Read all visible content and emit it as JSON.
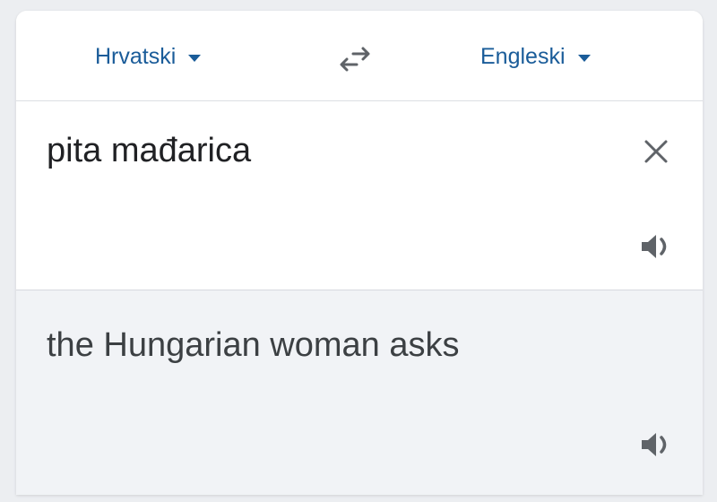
{
  "languages": {
    "source_label": "Hrvatski",
    "target_label": "Engleski"
  },
  "input": {
    "text": "pita mađarica"
  },
  "output": {
    "text": "the Hungarian woman asks"
  },
  "icons": {
    "swap": "swap-languages-icon",
    "clear": "close-icon",
    "speaker": "speaker-icon",
    "caret": "caret-down-icon"
  },
  "colors": {
    "accent": "#1a5c99",
    "text": "#202124",
    "output_bg": "#f1f3f6"
  }
}
